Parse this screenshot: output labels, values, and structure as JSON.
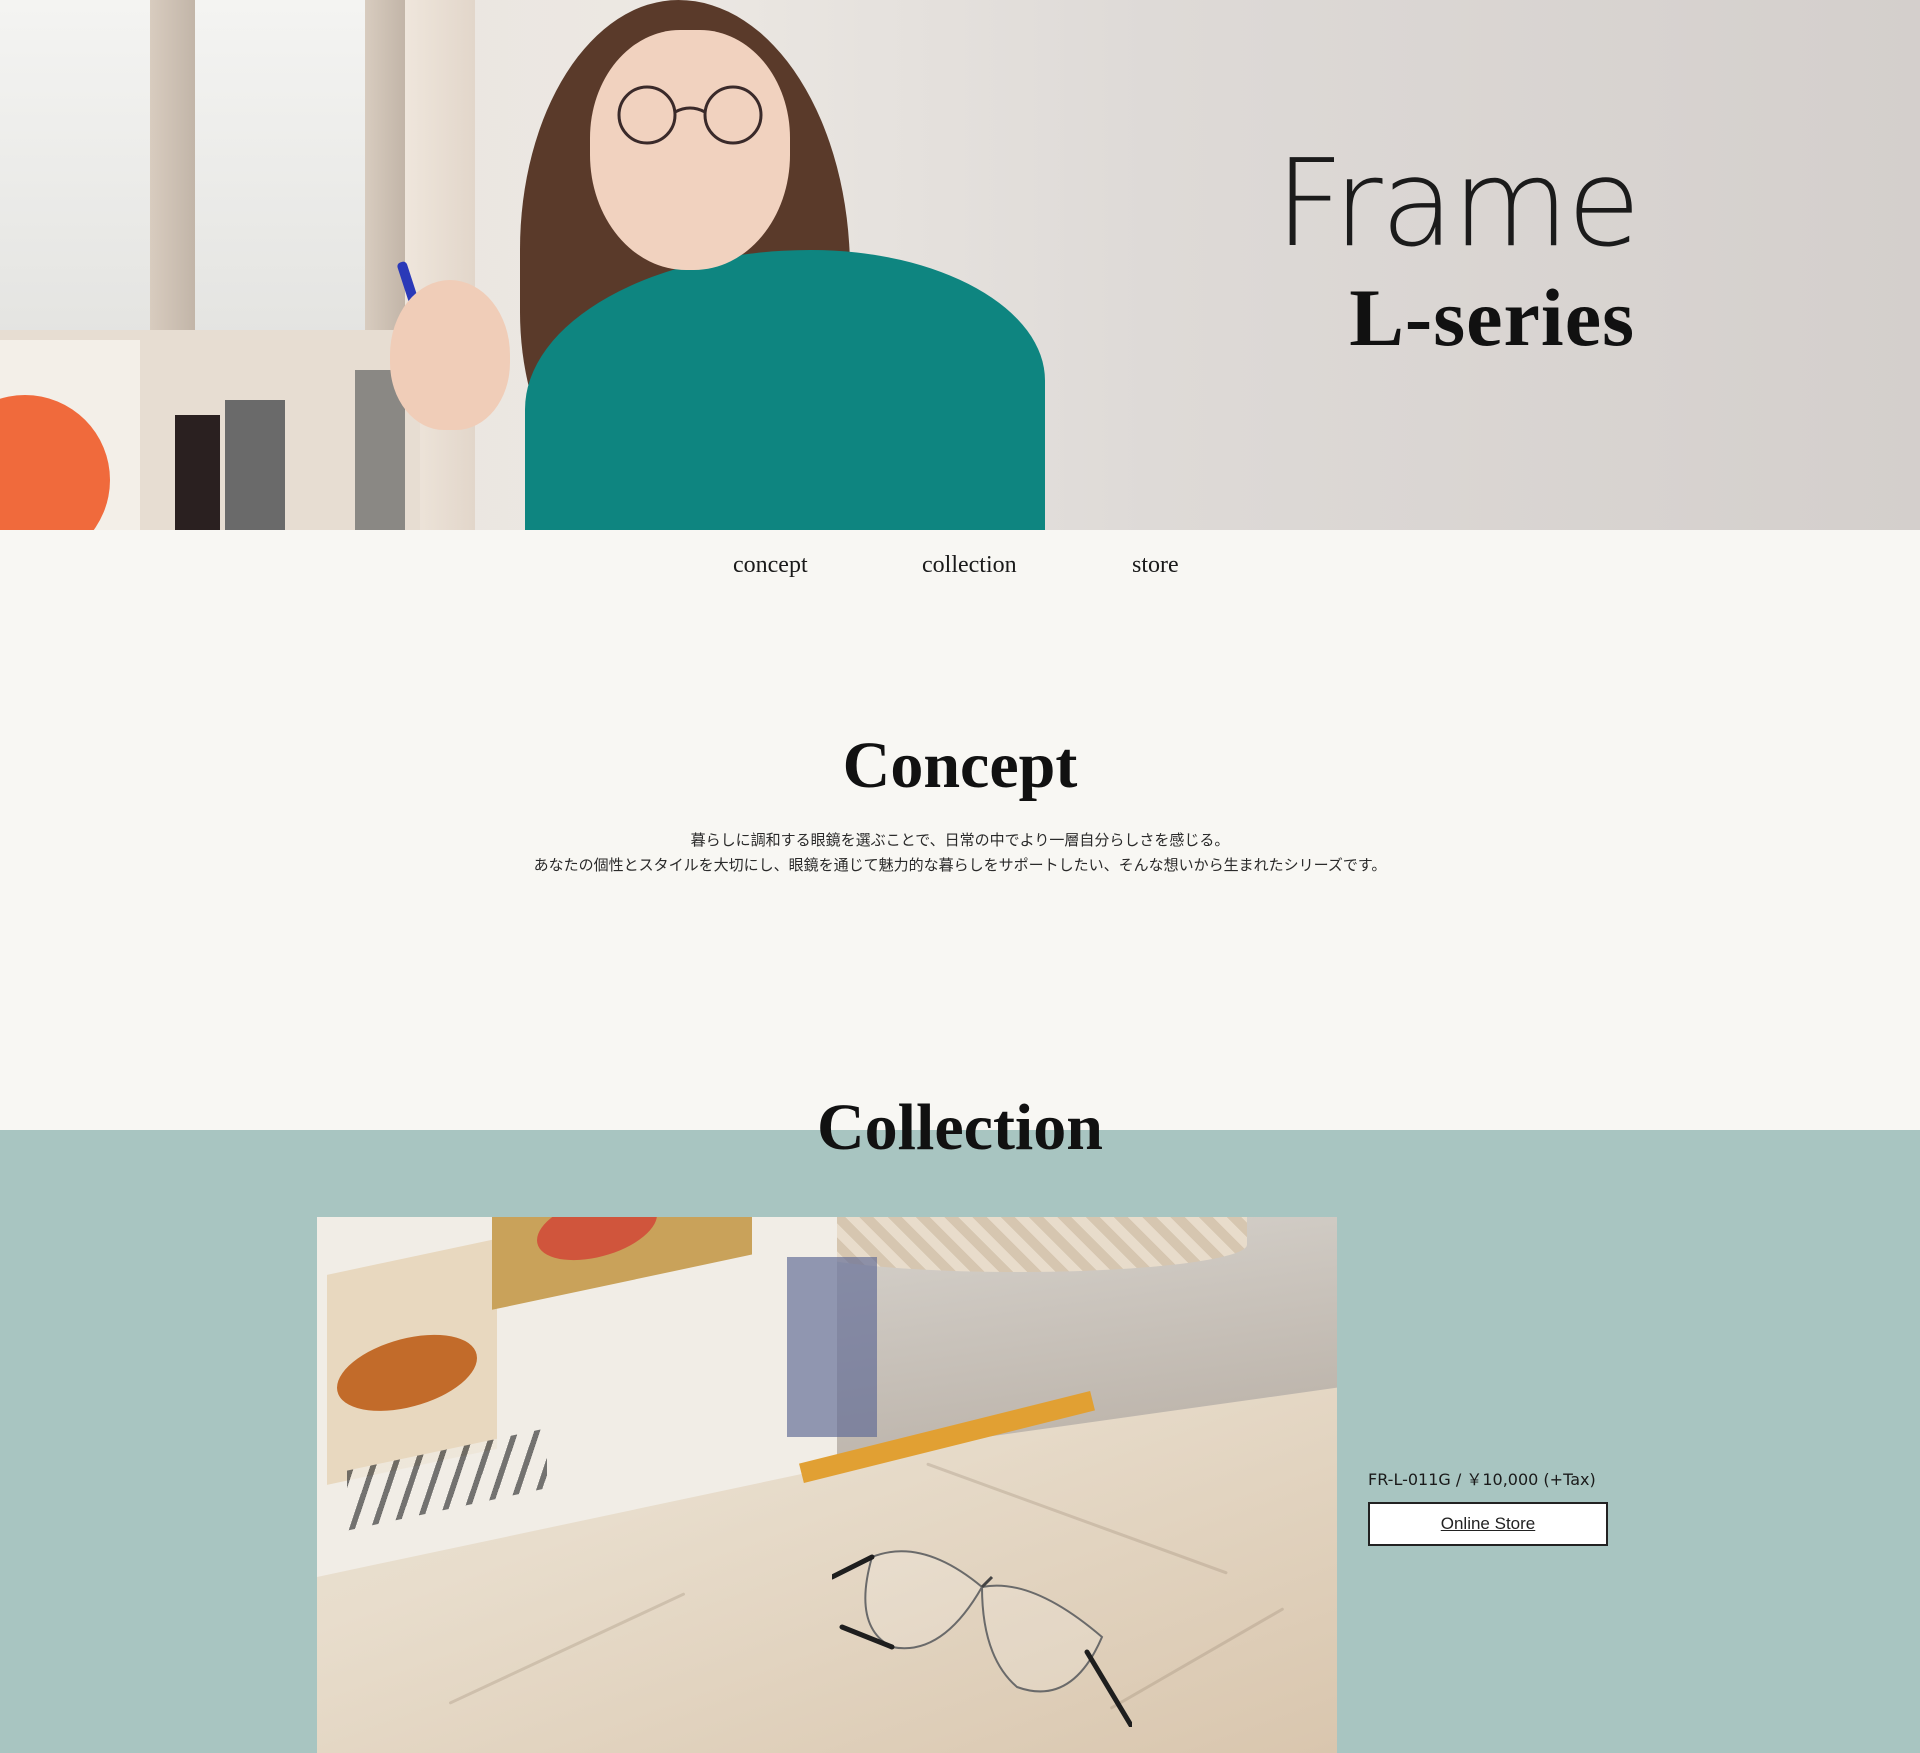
{
  "hero": {
    "title_line1": "Frame",
    "title_line2": "L-series"
  },
  "nav": {
    "items": [
      "concept",
      "collection",
      "store"
    ]
  },
  "concept": {
    "heading": "Concept",
    "line1": "暮らしに調和する眼鏡を選ぶことで、日常の中でより一層自分らしさを感じる。",
    "line2": "あなたの個性とスタイルを大切にし、眼鏡を通じて魅力的な暮らしをサポートしたい、そんな想いから生まれたシリーズです。"
  },
  "collection": {
    "heading": "Collection",
    "product_label": "FR-L-011G / ￥10,000 (+Tax)",
    "button_label": "Online Store"
  },
  "colors": {
    "page_bg": "#f8f7f3",
    "collection_bg": "#a8c5c1",
    "sweater": "#0e8580"
  }
}
